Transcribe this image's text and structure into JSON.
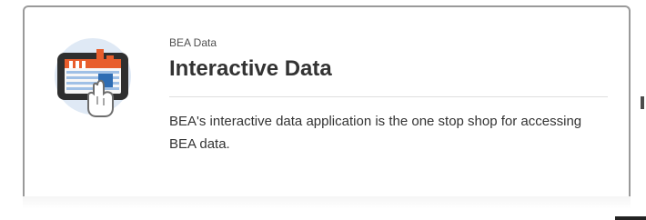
{
  "card": {
    "eyebrow": "BEA Data",
    "title": "Interactive Data",
    "description": "BEA's interactive data application is the one stop shop for accessing BEA data.",
    "icon": "interactive-data-tablet-icon"
  },
  "colors": {
    "border": "#9a9a9a",
    "text": "#333333",
    "accent_orange": "#e85d2c",
    "accent_blue": "#2f6db3"
  }
}
